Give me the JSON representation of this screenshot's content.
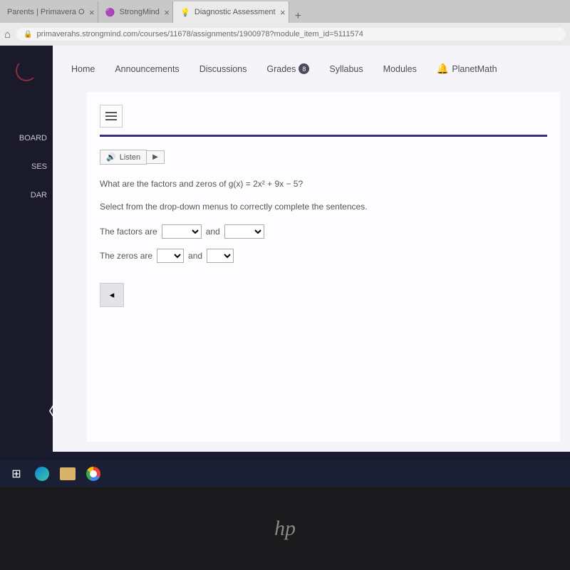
{
  "browser": {
    "tabs": [
      {
        "title": "Parents | Primavera O",
        "active": false
      },
      {
        "title": "StrongMind",
        "active": false
      },
      {
        "title": "Diagnostic Assessment",
        "active": true
      }
    ],
    "url": "primaverahs.strongmind.com/courses/11678/assignments/1900978?module_item_id=5111574"
  },
  "sidebar": {
    "items": [
      "BOARD",
      "SES",
      "DAR"
    ]
  },
  "topnav": {
    "home": "Home",
    "announcements": "Announcements",
    "discussions": "Discussions",
    "grades": "Grades",
    "grades_badge": "8",
    "syllabus": "Syllabus",
    "modules": "Modules",
    "planetmath": "PlanetMath"
  },
  "content": {
    "listen": "Listen",
    "question": "What are the factors and zeros of g(x) = 2x² + 9x − 5?",
    "instruction": "Select from the drop-down menus to correctly complete the sentences.",
    "factors_label": "The factors are",
    "and": "and",
    "zeros_label": "The zeros are",
    "prev": "◂"
  },
  "laptop_brand": "hp"
}
